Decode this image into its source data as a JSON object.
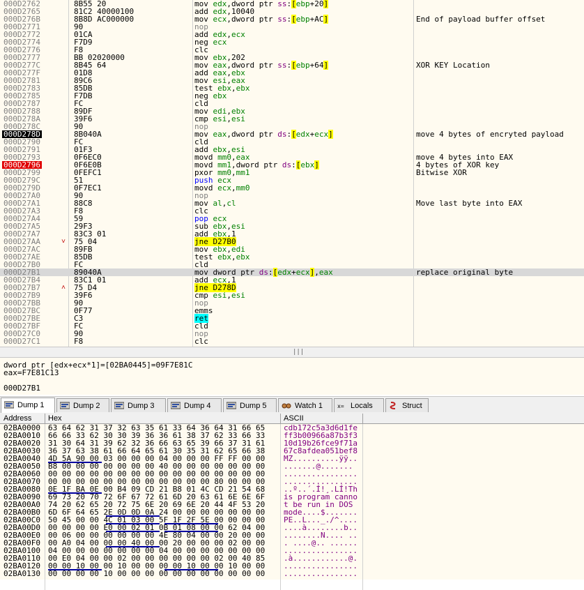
{
  "disasm": {
    "rows": [
      {
        "addr": "000D2762",
        "bytes": "8B55 20",
        "instr": "mov edx,dword ptr ss:[ebp+20]",
        "comment": ""
      },
      {
        "addr": "000D2765",
        "bytes": "81C2 40000100",
        "instr": "add edx,10040",
        "comment": ""
      },
      {
        "addr": "000D276B",
        "bytes": "8B8D AC000000",
        "instr": "mov ecx,dword ptr ss:[ebp+AC]",
        "comment": "End of payload buffer offset"
      },
      {
        "addr": "000D2771",
        "bytes": "90",
        "instr": "nop",
        "comment": ""
      },
      {
        "addr": "000D2772",
        "bytes": "01CA",
        "instr": "add edx,ecx",
        "comment": ""
      },
      {
        "addr": "000D2774",
        "bytes": "F7D9",
        "instr": "neg ecx",
        "comment": ""
      },
      {
        "addr": "000D2776",
        "bytes": "F8",
        "instr": "clc",
        "comment": ""
      },
      {
        "addr": "000D2777",
        "bytes": "BB 02020000",
        "instr": "mov ebx,202",
        "comment": ""
      },
      {
        "addr": "000D277C",
        "bytes": "8B45 64",
        "instr": "mov eax,dword ptr ss:[ebp+64]",
        "comment": "XOR KEY Location"
      },
      {
        "addr": "000D277F",
        "bytes": "01D8",
        "instr": "add eax,ebx",
        "comment": ""
      },
      {
        "addr": "000D2781",
        "bytes": "89C6",
        "instr": "mov esi,eax",
        "comment": ""
      },
      {
        "addr": "000D2783",
        "bytes": "85DB",
        "instr": "test ebx,ebx",
        "comment": ""
      },
      {
        "addr": "000D2785",
        "bytes": "F7DB",
        "instr": "neg ebx",
        "comment": ""
      },
      {
        "addr": "000D2787",
        "bytes": "FC",
        "instr": "cld",
        "comment": ""
      },
      {
        "addr": "000D2788",
        "bytes": "89DF",
        "instr": "mov edi,ebx",
        "comment": ""
      },
      {
        "addr": "000D278A",
        "bytes": "39F6",
        "instr": "cmp esi,esi",
        "comment": ""
      },
      {
        "addr": "000D278C",
        "bytes": "90",
        "instr": "nop",
        "comment": ""
      },
      {
        "addr": "000D278D",
        "bytes": "8B040A",
        "instr": "mov eax,dword ptr ds:[edx+ecx]",
        "comment": "move 4 bytes of encryted payload"
      },
      {
        "addr": "000D2790",
        "bytes": "FC",
        "instr": "cld",
        "comment": ""
      },
      {
        "addr": "000D2791",
        "bytes": "01F3",
        "instr": "add ebx,esi",
        "comment": ""
      },
      {
        "addr": "000D2793",
        "bytes": "0F6EC0",
        "instr": "movd mm0,eax",
        "comment": "move 4 bytes into EAX"
      },
      {
        "addr": "000D2796",
        "bytes": "0F6E0B",
        "instr": "movd mm1,dword ptr ds:[ebx]",
        "comment": "4 bytes of XOR key"
      },
      {
        "addr": "000D2799",
        "bytes": "0FEFC1",
        "instr": "pxor mm0,mm1",
        "comment": "Bitwise XOR"
      },
      {
        "addr": "000D279C",
        "bytes": "51",
        "instr": "push ecx",
        "comment": ""
      },
      {
        "addr": "000D279D",
        "bytes": "0F7EC1",
        "instr": "movd ecx,mm0",
        "comment": ""
      },
      {
        "addr": "000D27A0",
        "bytes": "90",
        "instr": "nop",
        "comment": ""
      },
      {
        "addr": "000D27A1",
        "bytes": "88C8",
        "instr": "mov al,cl",
        "comment": "Move last byte into EAX"
      },
      {
        "addr": "000D27A3",
        "bytes": "F8",
        "instr": "clc",
        "comment": ""
      },
      {
        "addr": "000D27A4",
        "bytes": "59",
        "instr": "pop ecx",
        "comment": ""
      },
      {
        "addr": "000D27A5",
        "bytes": "29F3",
        "instr": "sub ebx,esi",
        "comment": ""
      },
      {
        "addr": "000D27A7",
        "bytes": "83C3 01",
        "instr": "add ebx,1",
        "comment": ""
      },
      {
        "addr": "000D27AA",
        "bytes": "75 04",
        "instr": "jne D27B0",
        "comment": "",
        "arrow": "v"
      },
      {
        "addr": "000D27AC",
        "bytes": "89FB",
        "instr": "mov ebx,edi",
        "comment": ""
      },
      {
        "addr": "000D27AE",
        "bytes": "85DB",
        "instr": "test ebx,ebx",
        "comment": ""
      },
      {
        "addr": "000D27B0",
        "bytes": "FC",
        "instr": "cld",
        "comment": ""
      },
      {
        "addr": "000D27B1",
        "bytes": "89040A",
        "instr": "mov dword ptr ds:[edx+ecx],eax",
        "comment": "replace original byte"
      },
      {
        "addr": "000D27B4",
        "bytes": "83C1 01",
        "instr": "add ecx,1",
        "comment": ""
      },
      {
        "addr": "000D27B7",
        "bytes": "75 D4",
        "instr": "jne D278D",
        "comment": "",
        "arrow": "^"
      },
      {
        "addr": "000D27B9",
        "bytes": "39F6",
        "instr": "cmp esi,esi",
        "comment": ""
      },
      {
        "addr": "000D27BB",
        "bytes": "90",
        "instr": "nop",
        "comment": ""
      },
      {
        "addr": "000D27BC",
        "bytes": "0F77",
        "instr": "emms",
        "comment": ""
      },
      {
        "addr": "000D27BE",
        "bytes": "C3",
        "instr": "ret",
        "comment": ""
      },
      {
        "addr": "000D27BF",
        "bytes": "FC",
        "instr": "cld",
        "comment": ""
      },
      {
        "addr": "000D27C0",
        "bytes": "90",
        "instr": "nop",
        "comment": ""
      },
      {
        "addr": "000D27C1",
        "bytes": "F8",
        "instr": "clc",
        "comment": ""
      }
    ]
  },
  "info": {
    "line1": "dword ptr [edx+ecx*1]=[02BA0445]=09F7E81C",
    "line2": "eax=F7E81C13",
    "line3": "000D27B1"
  },
  "tabs": [
    {
      "label": "Dump 1",
      "icon": "dump-icon"
    },
    {
      "label": "Dump 2",
      "icon": "dump-icon"
    },
    {
      "label": "Dump 3",
      "icon": "dump-icon"
    },
    {
      "label": "Dump 4",
      "icon": "dump-icon"
    },
    {
      "label": "Dump 5",
      "icon": "dump-icon"
    },
    {
      "label": "Watch 1",
      "icon": "watch-icon"
    },
    {
      "label": "Locals",
      "icon": "locals-icon",
      "prefix": "[x=]"
    },
    {
      "label": "Struct",
      "icon": "struct-icon"
    }
  ],
  "dump": {
    "header": {
      "address": "Address",
      "hex": "Hex",
      "ascii": "ASCII"
    },
    "rows": [
      {
        "addr": "02BA0000",
        "hex": "63 64 62 31 37 32 63 35 61 33 64 36 64 31 66 65",
        "ascii": "cdb172c5a3d6d1fe"
      },
      {
        "addr": "02BA0010",
        "hex": "66 66 33 62 30 30 39 36 36 61 38 37 62 33 66 33",
        "ascii": "ff3b00966a87b3f3"
      },
      {
        "addr": "02BA0020",
        "hex": "31 30 64 31 39 62 32 36 66 63 65 39 66 37 31 61",
        "ascii": "10d19b26fce9f71a"
      },
      {
        "addr": "02BA0030",
        "hex": "36 37 63 38 61 66 64 65 61 30 35 31 62 65 66 38",
        "ascii": "67c8afdea051bef8"
      },
      {
        "addr": "02BA0040",
        "hex": "4D 5A 90 00 03 00 00 00 04 00 00 00 FF FF 00 00",
        "ascii": "MZ..........ÿÿ.."
      },
      {
        "addr": "02BA0050",
        "hex": "B8 00 00 00 00 00 00 00 40 00 00 00 00 00 00 00",
        "ascii": ".......@......."
      },
      {
        "addr": "02BA0060",
        "hex": "00 00 00 00 00 00 00 00 00 00 00 00 00 00 00 00",
        "ascii": "................"
      },
      {
        "addr": "02BA0070",
        "hex": "00 00 00 00 00 00 00 00 00 00 00 00 80 00 00 00",
        "ascii": "................"
      },
      {
        "addr": "02BA0080",
        "hex": "0E 1F BA 0E 00 B4 09 CD 21 B8 01 4C CD 21 54 68",
        "ascii": "..º..´.Í!¸.LÍ!Th"
      },
      {
        "addr": "02BA0090",
        "hex": "69 73 20 70 72 6F 67 72 61 6D 20 63 61 6E 6E 6F",
        "ascii": "is program canno"
      },
      {
        "addr": "02BA00A0",
        "hex": "74 20 62 65 20 72 75 6E 20 69 6E 20 44 4F 53 20",
        "ascii": "t be run in DOS "
      },
      {
        "addr": "02BA00B0",
        "hex": "6D 6F 64 65 2E 0D 0D 0A 24 00 00 00 00 00 00 00",
        "ascii": "mode....$......."
      },
      {
        "addr": "02BA00C0",
        "hex": "50 45 00 00 4C 01 03 00 5F 1F 2F 5E 00 00 00 00",
        "ascii": "PE..L..._./^...."
      },
      {
        "addr": "02BA00D0",
        "hex": "00 00 00 00 E0 00 02 01 0B 01 08 00 00 62 04 00",
        "ascii": "....à........b.."
      },
      {
        "addr": "02BA00E0",
        "hex": "00 06 00 00 00 00 00 00 4E 80 04 00 00 20 00 00",
        "ascii": "........N.... .."
      },
      {
        "addr": "02BA00F0",
        "hex": "00 A0 04 00 00 00 40 00 00 20 00 00 00 02 00 00",
        "ascii": ". ....@.. ......"
      },
      {
        "addr": "02BA0100",
        "hex": "04 00 00 00 00 00 00 00 04 00 00 00 00 00 00 00",
        "ascii": "................"
      },
      {
        "addr": "02BA0110",
        "hex": "00 E0 04 00 00 02 00 00 00 00 00 00 02 00 40 85",
        "ascii": ".à............@."
      },
      {
        "addr": "02BA0120",
        "hex": "00 00 10 00 00 10 00 00 00 00 10 00 00 10 00 00",
        "ascii": "................"
      },
      {
        "addr": "02BA0130",
        "hex": "00 00 00 00 10 00 00 00 00 00 00 00 00 00 00 00",
        "ascii": "................"
      }
    ]
  }
}
